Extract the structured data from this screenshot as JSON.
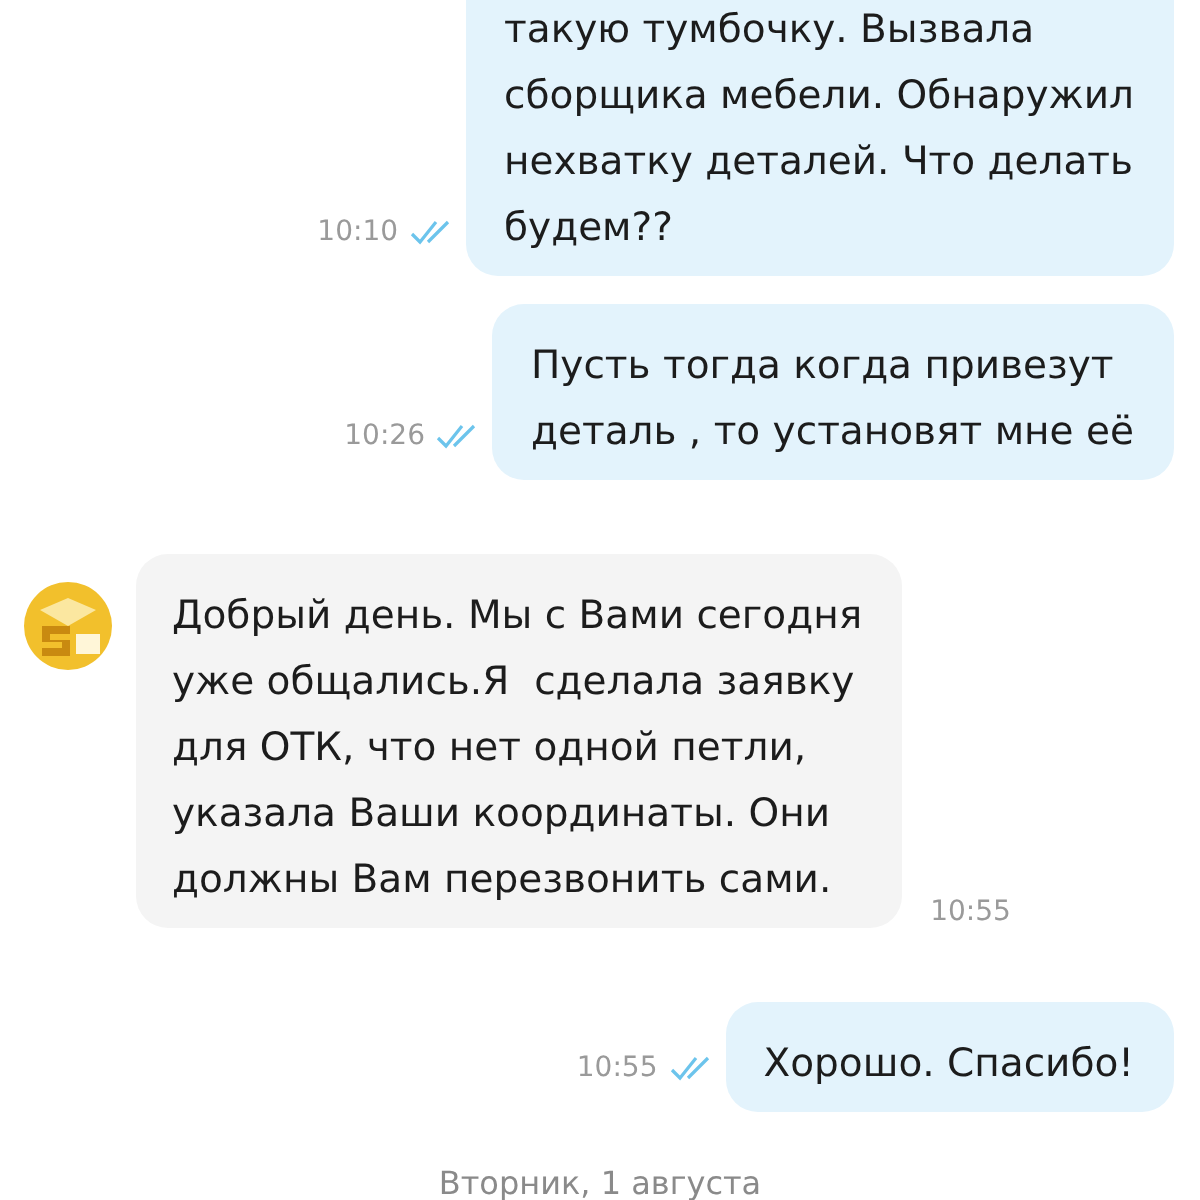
{
  "messages": [
    {
      "kind": "outgoing",
      "lines": [
        "такую тумбочку. Вызвала",
        "сборщика мебели. Обнаружил",
        "нехватку деталей. Что делать",
        "будем??"
      ],
      "time": "10:10",
      "read": true
    },
    {
      "kind": "outgoing",
      "lines": [
        "Пусть тогда когда привезут",
        "деталь , то установят мне её"
      ],
      "time": "10:26",
      "read": true
    },
    {
      "kind": "incoming",
      "lines": [
        "Добрый день. Мы с Вами сегодня",
        "уже общались.Я  сделала заявку",
        "для ОТК, что нет одной петли,",
        "указала Ваши координаты. Они",
        "должны Вам перезвонить сами."
      ],
      "time": "10:55"
    },
    {
      "kind": "outgoing",
      "lines": [
        "Хорошо. Спасибо!"
      ],
      "time": "10:55",
      "read": true
    }
  ],
  "date_separator": "Вторник, 1 августа"
}
